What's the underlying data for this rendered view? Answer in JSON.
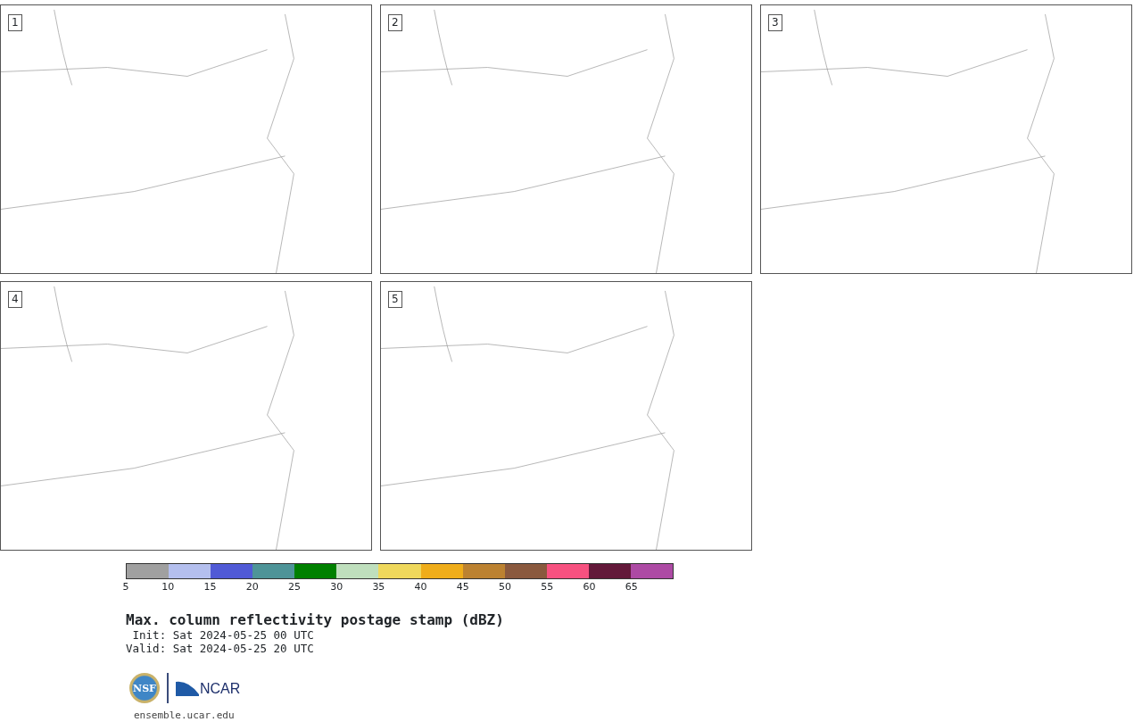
{
  "panels": [
    {
      "label": "1"
    },
    {
      "label": "2"
    },
    {
      "label": "3"
    },
    {
      "label": "4"
    },
    {
      "label": "5"
    }
  ],
  "colorbar": {
    "segments": [
      {
        "color": "#a0a0a0"
      },
      {
        "color": "#b4bfee"
      },
      {
        "color": "#505ad6"
      },
      {
        "color": "#4e9498"
      },
      {
        "color": "#008000"
      },
      {
        "color": "#bfdfbd"
      },
      {
        "color": "#efd85c"
      },
      {
        "color": "#efad1a"
      },
      {
        "color": "#bc8231"
      },
      {
        "color": "#8a593e"
      },
      {
        "color": "#f75180"
      },
      {
        "color": "#63193a"
      },
      {
        "color": "#ad4aa4"
      }
    ],
    "ticks": [
      "5",
      "10",
      "15",
      "20",
      "25",
      "30",
      "35",
      "40",
      "45",
      "50",
      "55",
      "60",
      "65"
    ]
  },
  "title": "Max. column reflectivity postage stamp (dBZ)",
  "init": " Init: Sat 2024-05-25 00 UTC",
  "valid": "Valid: Sat 2024-05-25 20 UTC",
  "logo": {
    "seal_text": "NSF",
    "wordmark": "NCAR"
  },
  "url": "ensemble.ucar.edu"
}
